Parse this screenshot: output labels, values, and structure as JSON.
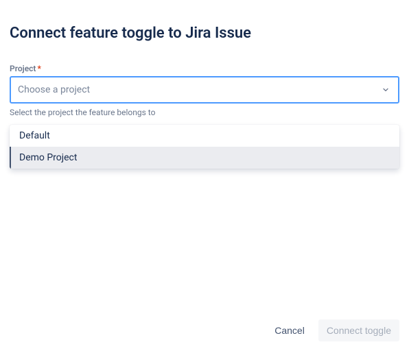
{
  "title": "Connect feature toggle to Jira Issue",
  "field": {
    "label": "Project",
    "required": "*",
    "placeholder": "Choose a project",
    "helper": "Select the project the feature belongs to"
  },
  "options": [
    {
      "label": "Default"
    },
    {
      "label": "Demo Project"
    }
  ],
  "footer": {
    "cancel": "Cancel",
    "submit": "Connect toggle"
  }
}
